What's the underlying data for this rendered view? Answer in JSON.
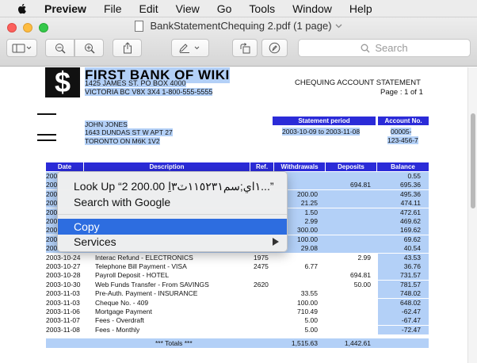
{
  "menubar": {
    "app": "Preview",
    "items": [
      "File",
      "Edit",
      "View",
      "Go",
      "Tools",
      "Window",
      "Help"
    ]
  },
  "window": {
    "title": "BankStatementChequing 2.pdf (1 page)",
    "search_placeholder": "Search"
  },
  "document": {
    "bank_name": "FIRST BANK OF WIKI",
    "bank_address_1": "1425 JAMES ST. PO BOX 4000",
    "bank_address_2": "VICTORIA BC  V8X 3X4    1-800-555-5555",
    "statement_title": "CHEQUING ACCOUNT STATEMENT",
    "page_label": "Page : 1 of 1",
    "customer_name": "JOHN JONES",
    "customer_address_1": "1643 DUNDAS ST W APT 27",
    "customer_address_2": "TORONTO ON   M6K 1V2",
    "statement_period_label": "Statement period",
    "statement_period_value": "2003-10-09 to 2003-11-08",
    "account_label": "Account No.",
    "account_value_1": "00005-",
    "account_value_2": "123-456-7"
  },
  "table": {
    "headers": [
      "Date",
      "Description",
      "Ref.",
      "Withdrawals",
      "Deposits",
      "Balance"
    ],
    "rows": [
      {
        "date": "200",
        "desc": "",
        "ref": "",
        "wd": "",
        "dep": "",
        "bal": "0.55"
      },
      {
        "date": "200",
        "desc": "",
        "ref": "",
        "wd": "",
        "dep": "694.81",
        "bal": "695.36"
      },
      {
        "date": "200",
        "desc": "",
        "ref": "",
        "wd": "200.00",
        "dep": "",
        "bal": "495.36"
      },
      {
        "date": "200",
        "desc": "",
        "ref": "",
        "wd": "21.25",
        "dep": "",
        "bal": "474.11"
      },
      {
        "date": "200",
        "desc": "",
        "ref": "",
        "wd": "1.50",
        "dep": "",
        "bal": "472.61"
      },
      {
        "date": "200",
        "desc": "",
        "ref": "",
        "wd": "2.99",
        "dep": "",
        "bal": "469.62"
      },
      {
        "date": "200",
        "desc": "",
        "ref": "",
        "wd": "300.00",
        "dep": "",
        "bal": "169.62"
      },
      {
        "date": "200",
        "desc": "",
        "ref": "",
        "wd": "100.00",
        "dep": "",
        "bal": "69.62"
      },
      {
        "date": "200",
        "desc": "",
        "ref": "",
        "wd": "29.08",
        "dep": "",
        "bal": "40.54"
      },
      {
        "date": "2003-10-24",
        "desc": "Interac Refund - ELECTRONICS",
        "ref": "1975",
        "wd": "",
        "dep": "2.99",
        "bal": "43.53"
      },
      {
        "date": "2003-10-27",
        "desc": "Telephone Bill Payment - VISA",
        "ref": "2475",
        "wd": "6.77",
        "dep": "",
        "bal": "36.76"
      },
      {
        "date": "2003-10-28",
        "desc": "Payroll Deposit - HOTEL",
        "ref": "",
        "wd": "",
        "dep": "694.81",
        "bal": "731.57"
      },
      {
        "date": "2003-10-30",
        "desc": "Web Funds Transfer - From  SAVINGS",
        "ref": "2620",
        "wd": "",
        "dep": "50.00",
        "bal": "781.57"
      },
      {
        "date": "2003-11-03",
        "desc": "Pre-Auth. Payment - INSURANCE",
        "ref": "",
        "wd": "33.55",
        "dep": "",
        "bal": "748.02"
      },
      {
        "date": "2003-11-03",
        "desc": "Cheque No. - 409",
        "ref": "",
        "wd": "100.00",
        "dep": "",
        "bal": "648.02"
      },
      {
        "date": "2003-11-06",
        "desc": "Mortgage Payment",
        "ref": "",
        "wd": "710.49",
        "dep": "",
        "bal": "-62.47"
      },
      {
        "date": "2003-11-07",
        "desc": "Fees - Overdraft",
        "ref": "",
        "wd": "5.00",
        "dep": "",
        "bal": "-67.47"
      },
      {
        "date": "2003-11-08",
        "desc": "Fees - Monthly",
        "ref": "",
        "wd": "5.00",
        "dep": "",
        "bal": "-72.47"
      }
    ],
    "totals_label": "*** Totals ***",
    "totals_withdrawals": "1,515.63",
    "totals_deposits": "1,442.61"
  },
  "context_menu": {
    "items": [
      "Look Up “١اي;سم١١٥٢٣١ٽ٣اِ 200.00 2...”",
      "Search with Google",
      "Copy",
      "Services"
    ],
    "highlighted_index": 2
  },
  "colors": {
    "selection": "#b3d0f7",
    "header_blue": "#2b2bd8",
    "menu_highlight": "#2d6de0"
  }
}
